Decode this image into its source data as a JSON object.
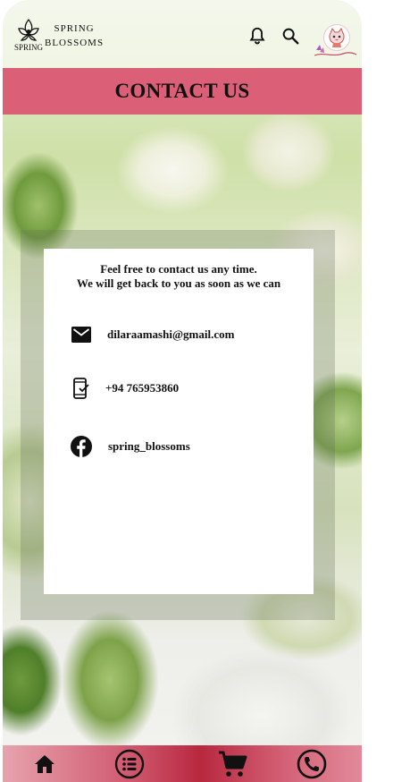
{
  "header": {
    "brand_line1": "SPRING",
    "brand_line2": "BLOSSOMS",
    "logo_text": "SPRING",
    "bell_icon": "bell-icon",
    "search_icon": "search-icon",
    "avatar_icon": "cat-avatar-icon"
  },
  "page": {
    "title": "CONTACT US"
  },
  "card": {
    "intro_line1": "Feel free to contact us any time.",
    "intro_line2": "We will get back to you as soon as we can",
    "email": "dilaraamashi@gmail.com",
    "phone": "+94 765953860",
    "facebook": "spring_blossoms"
  },
  "bottom_nav": {
    "items": [
      "home-icon",
      "list-icon",
      "cart-icon",
      "phone-icon"
    ]
  },
  "colors": {
    "title_bar": "#dc5f78",
    "bottom_bar_start": "#e7a3ad",
    "bottom_bar_mid": "#b8283f",
    "text": "#111111"
  }
}
